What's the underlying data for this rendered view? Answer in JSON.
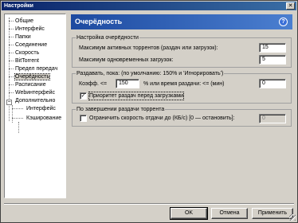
{
  "window": {
    "title": "Настройки",
    "close_label": "✕"
  },
  "sidebar": {
    "items": [
      {
        "label": "Общие"
      },
      {
        "label": "Интерфейс"
      },
      {
        "label": "Папки"
      },
      {
        "label": "Соединение"
      },
      {
        "label": "Скорость"
      },
      {
        "label": "BitTorrent"
      },
      {
        "label": "Предел передач"
      },
      {
        "label": "Очерёдность"
      },
      {
        "label": "Расписание"
      },
      {
        "label": "Webинтерфейс"
      },
      {
        "label": "Дополнительно"
      },
      {
        "label": "Интерфейс"
      },
      {
        "label": "Кэширование"
      }
    ],
    "selected_index": 7,
    "expander_symbol": "−"
  },
  "header": {
    "title": "Очерёдность",
    "help_label": "?"
  },
  "queue_settings": {
    "title": "Настройка очерёдности",
    "max_active_torrents_label": "Максимум активных торрентов (раздач или загрузок):",
    "max_active_torrents_value": "15",
    "max_simultaneous_downloads_label": "Максимум одновременных загрузок:",
    "max_simultaneous_downloads_value": "5"
  },
  "seeding": {
    "title": "Раздавать, пока: (по умолчанию: 150% и 'Игнорировать')",
    "ratio_label": "Коэфф. <=",
    "ratio_value": "150",
    "time_label": "% или время раздачи: <= (мин)",
    "time_value": "0",
    "priority_label": "Приоритет раздач перед загрузками",
    "priority_checked": true,
    "check_symbol": "✓"
  },
  "after_seeding": {
    "title": "По завершении раздачи торрента",
    "limit_label": "Ограничить скорость отдачи до (КБ/с) [0 — остановить]:",
    "limit_checked": false,
    "limit_value": "0"
  },
  "footer": {
    "ok_label": "OK",
    "cancel_label": "Отмена",
    "apply_label": "Применить"
  },
  "colors": {
    "header_bg": "#1d4aa0",
    "title_bar": "#0a246a",
    "window_bg": "#d4d0c8"
  }
}
